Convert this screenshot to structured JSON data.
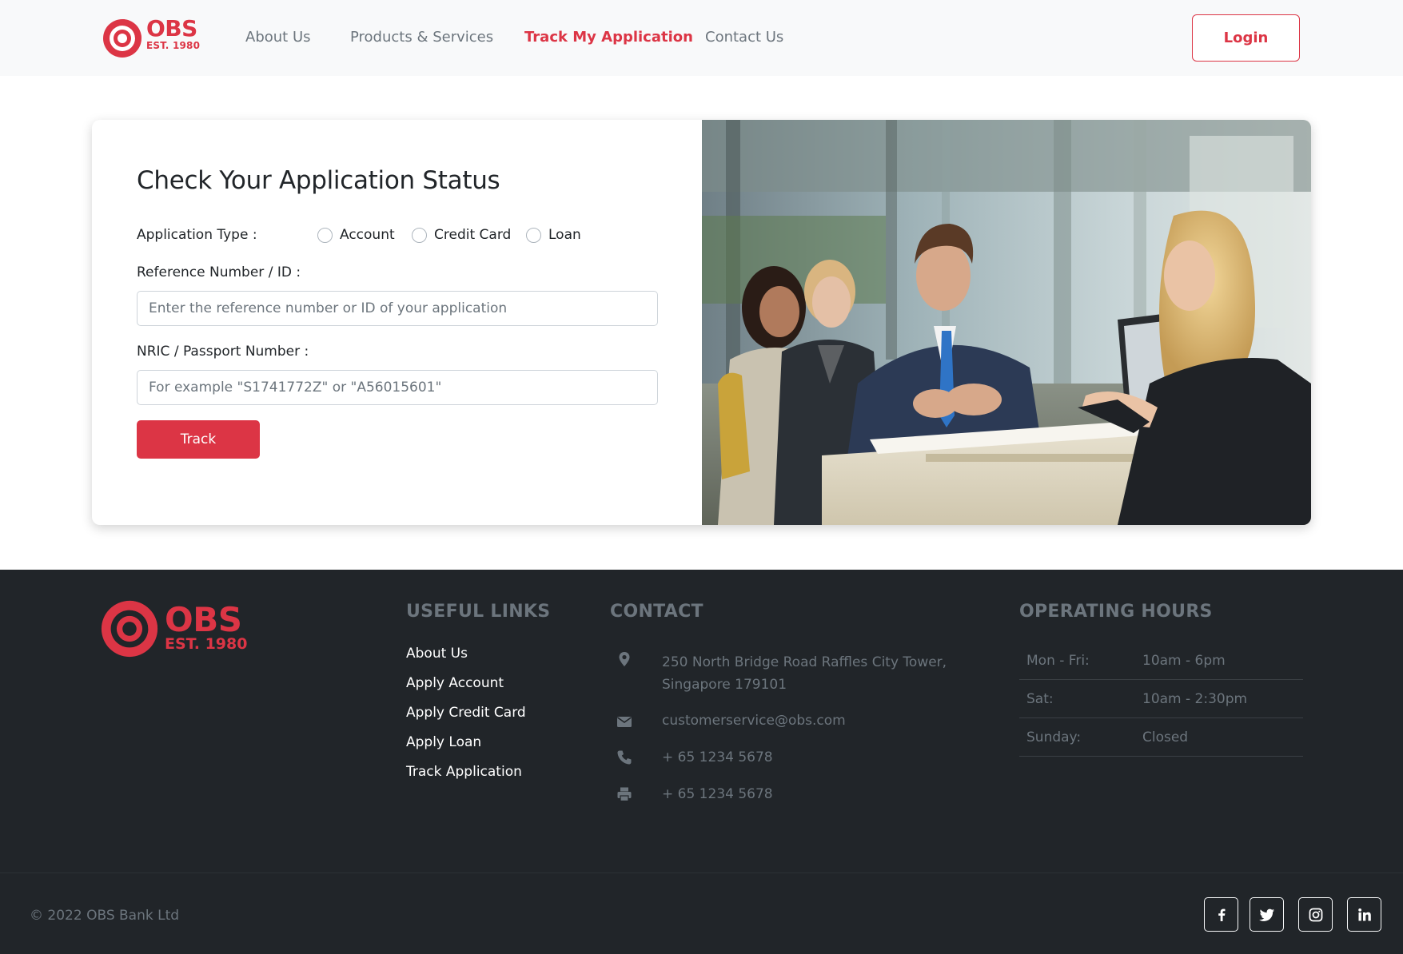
{
  "brand": {
    "name": "OBS",
    "est": "EST. 1980",
    "color": "#dc3545"
  },
  "nav": {
    "items": [
      {
        "label": "About Us",
        "active": false
      },
      {
        "label": "Products & Services",
        "active": false
      },
      {
        "label": "Track My Application",
        "active": true
      },
      {
        "label": "Contact Us",
        "active": false
      }
    ],
    "login_label": "Login"
  },
  "form": {
    "title": "Check Your Application Status",
    "application_type_label": "Application Type :",
    "application_types": [
      "Account",
      "Credit Card",
      "Loan"
    ],
    "reference_label": "Reference Number / ID :",
    "reference_placeholder": "Enter the reference number or ID of your application",
    "reference_value": "",
    "nric_label": "NRIC / Passport Number :",
    "nric_placeholder": "For example \"S1741772Z\" or \"A56015601\"",
    "nric_value": "",
    "submit_label": "Track"
  },
  "hero_image": {
    "icon": "bank-counter-photo"
  },
  "footer": {
    "useful_links_heading": "USEFUL LINKS",
    "useful_links": [
      "About Us",
      "Apply Account",
      "Apply Credit Card",
      "Apply Loan",
      "Track Application"
    ],
    "contact_heading": "CONTACT",
    "contact": {
      "address_line1": "250 North Bridge Road Raffles City Tower,",
      "address_line2": "Singapore 179101",
      "email": "customerservice@obs.com",
      "phone": "+ 65 1234 5678",
      "fax": "+ 65 1234 5678"
    },
    "hours_heading": "OPERATING HOURS",
    "hours": [
      {
        "day": "Mon - Fri:",
        "time": "10am - 6pm"
      },
      {
        "day": "Sat:",
        "time": "10am - 2:30pm"
      },
      {
        "day": "Sunday:",
        "time": "Closed"
      }
    ],
    "copyright": "© 2022 OBS Bank Ltd",
    "social": [
      "facebook-icon",
      "twitter-icon",
      "instagram-icon",
      "linkedin-icon"
    ]
  }
}
